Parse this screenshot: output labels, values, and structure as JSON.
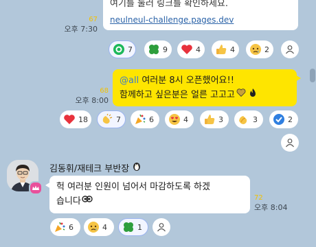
{
  "msg1": {
    "text_line": "여기를 눌러 링크를 확인하세요.",
    "link": "neulneul-challenge.pages.dev",
    "unread": "67",
    "time": "오후 7:30",
    "reactions": [
      {
        "icon": "green-circle-icon",
        "count": "7"
      },
      {
        "icon": "four-leaf-clover-icon",
        "count": "9"
      },
      {
        "icon": "heart-icon",
        "count": "4"
      },
      {
        "icon": "thumbs-up-icon",
        "count": "4"
      },
      {
        "icon": "crying-face-icon",
        "count": "2"
      }
    ]
  },
  "msg2": {
    "mention": "@all",
    "line1": " 여러분 8시 오픈했어요!!",
    "line2": "함께하고 싶은분은 얼른 고고고",
    "unread": "68",
    "time": "오후 8:00",
    "reactions": [
      {
        "icon": "heart-icon",
        "count": "18"
      },
      {
        "icon": "clapping-hands-icon",
        "count": "7"
      },
      {
        "icon": "party-popper-icon",
        "count": "6"
      },
      {
        "icon": "heart-eyes-face-icon",
        "count": "4"
      },
      {
        "icon": "thumbs-up-icon",
        "count": "3"
      },
      {
        "icon": "applause-icon",
        "count": "3"
      },
      {
        "icon": "check-mark-icon",
        "count": "2"
      }
    ]
  },
  "msg3": {
    "sender": "김동휘/재테크 부반장",
    "line1": "헉 여러분 인원이 넘어서 마감하도록 하겠",
    "line2": "습니다",
    "unread": "72",
    "time": "오후 8:04",
    "reactions": [
      {
        "icon": "party-popper-icon",
        "count": "6"
      },
      {
        "icon": "crying-face-icon",
        "count": "4"
      },
      {
        "icon": "four-leaf-clover-icon",
        "count": "1"
      }
    ]
  },
  "colors": {
    "background": "#b2c7da",
    "my_bubble": "#fee500",
    "unread_count": "#f2c100",
    "active_reaction_border": "#9ab3f0"
  }
}
